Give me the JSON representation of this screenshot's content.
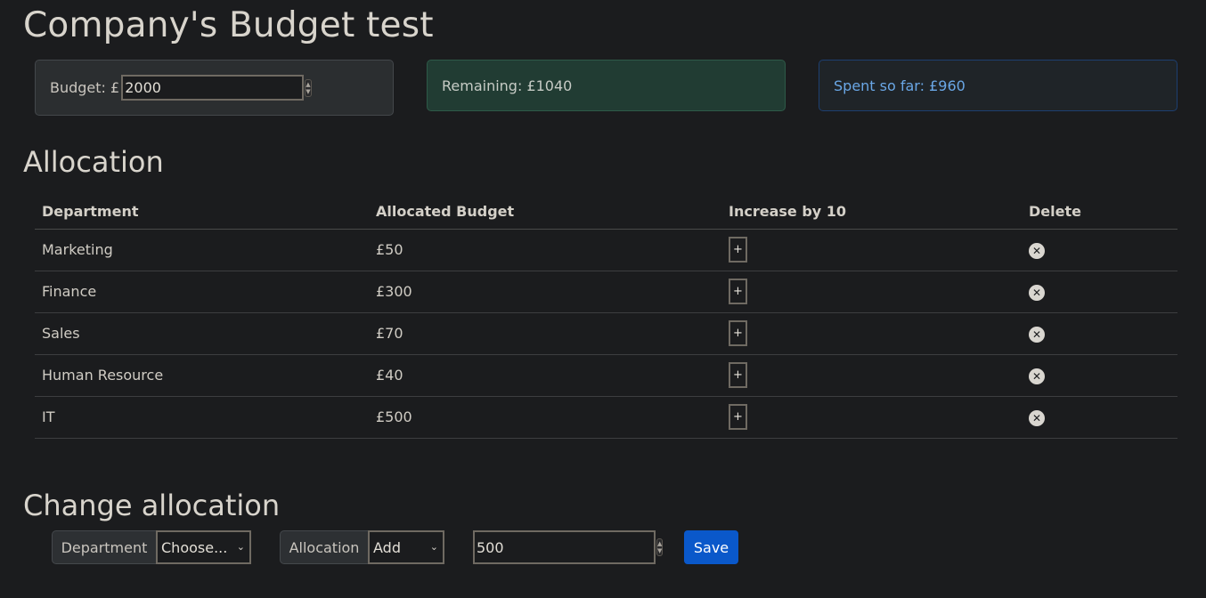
{
  "page_title": "Company's Budget test",
  "budget": {
    "label": "Budget: £",
    "value": "2000"
  },
  "remaining": {
    "text": "Remaining: £1040"
  },
  "spent": {
    "text": "Spent so far: £960"
  },
  "allocation": {
    "heading": "Allocation",
    "columns": [
      "Department",
      "Allocated Budget",
      "Increase by 10",
      "Delete"
    ],
    "rows": [
      {
        "department": "Marketing",
        "budget": "£50"
      },
      {
        "department": "Finance",
        "budget": "£300"
      },
      {
        "department": "Sales",
        "budget": "£70"
      },
      {
        "department": "Human Resource",
        "budget": "£40"
      },
      {
        "department": "IT",
        "budget": "£500"
      }
    ],
    "increase_symbol": "+",
    "delete_icon": "close-circle-icon"
  },
  "change": {
    "heading": "Change allocation",
    "department_label": "Department",
    "department_selected": "Choose...",
    "allocation_label": "Allocation",
    "allocation_selected": "Add",
    "amount_value": "500",
    "save_label": "Save"
  },
  "colors": {
    "background": "#1b1c1e",
    "remaining_bg": "#213c33",
    "spent_text": "#6aa7e6",
    "save_button": "#0a58ca"
  }
}
